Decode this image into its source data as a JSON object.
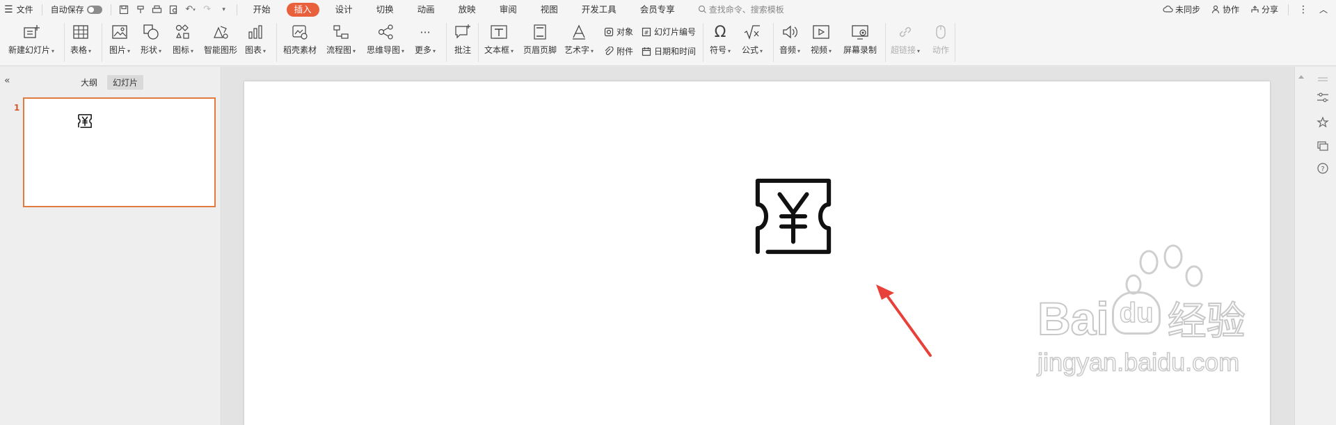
{
  "menubar": {
    "file": "文件",
    "autosave": "自动保存",
    "tabs": [
      "开始",
      "插入",
      "设计",
      "切换",
      "动画",
      "放映",
      "审阅",
      "视图",
      "开发工具",
      "会员专享"
    ],
    "active_tab": "插入",
    "search_placeholder": "查找命令、搜索模板",
    "unsynced": "未同步",
    "collaborate": "协作",
    "share": "分享"
  },
  "ribbon": {
    "new_slide": "新建幻灯片",
    "table": "表格",
    "image": "图片",
    "shape": "形状",
    "icon": "图标",
    "smartart": "智能图形",
    "chart": "图表",
    "material": "稻壳素材",
    "flowchart": "流程图",
    "mindmap": "思维导图",
    "more": "更多",
    "comment": "批注",
    "textbox": "文本框",
    "header_footer": "页眉页脚",
    "wordart": "艺术字",
    "object": "对象",
    "attachment": "附件",
    "slide_number": "幻灯片编号",
    "datetime": "日期和时间",
    "symbol": "符号",
    "formula": "公式",
    "audio": "音频",
    "video": "视频",
    "screen_record": "屏幕录制",
    "hyperlink": "超链接",
    "action": "动作"
  },
  "leftpanel": {
    "tab_outline": "大纲",
    "tab_slides": "幻灯片",
    "slide_number": "1"
  },
  "watermark": {
    "brand_a": "Bai",
    "brand_b": "du",
    "brand_cn": "经验",
    "url": "jingyan.baidu.com"
  },
  "colors": {
    "accent": "#e9603c",
    "thumb_border": "#e07a3f",
    "arrow": "#e8413a"
  }
}
